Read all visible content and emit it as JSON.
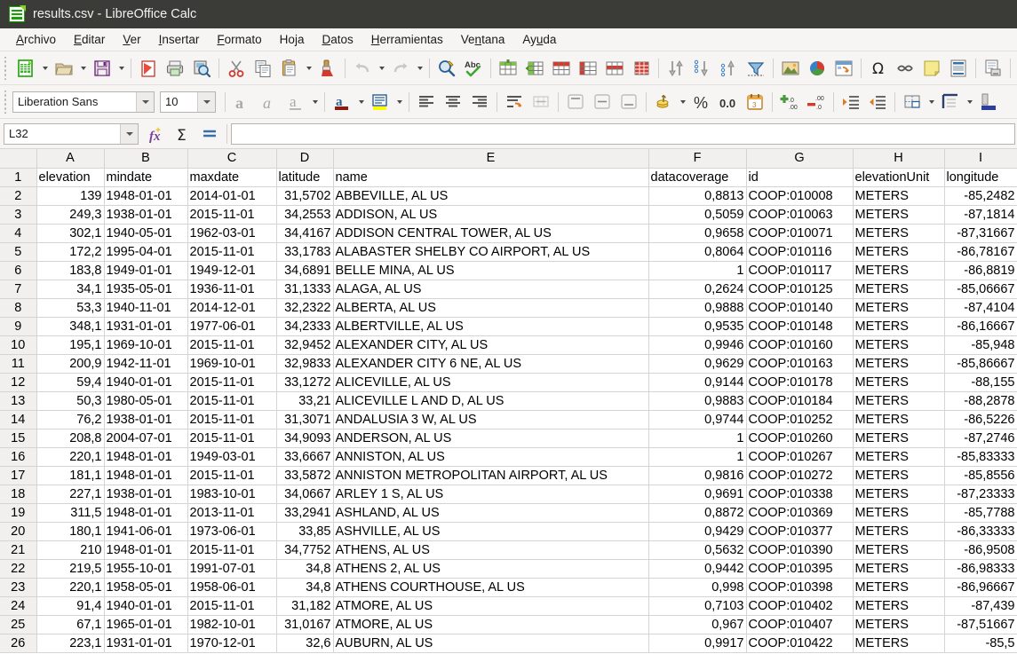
{
  "window": {
    "title": "results.csv - LibreOffice Calc",
    "icon": "calc-document-icon"
  },
  "menubar": {
    "items": [
      {
        "label": "Archivo",
        "accel": "A"
      },
      {
        "label": "Editar",
        "accel": "E"
      },
      {
        "label": "Ver",
        "accel": "V"
      },
      {
        "label": "Insertar",
        "accel": "I"
      },
      {
        "label": "Formato",
        "accel": "F"
      },
      {
        "label": "Hoja",
        "accel": "j"
      },
      {
        "label": "Datos",
        "accel": "D"
      },
      {
        "label": "Herramientas",
        "accel": "H"
      },
      {
        "label": "Ventana",
        "accel": "n"
      },
      {
        "label": "Ayuda",
        "accel": "u"
      }
    ]
  },
  "standard_toolbar": {
    "icons": [
      "new-document-icon",
      "open-file-icon",
      "save-icon",
      "export-pdf-icon",
      "print-icon",
      "print-preview-icon",
      "cut-icon",
      "copy-icon",
      "paste-icon",
      "clone-formatting-icon",
      "undo-icon",
      "redo-icon",
      "find-replace-icon",
      "spelling-icon",
      "insert-table-icon",
      "row-icon",
      "column-icon",
      "delete-row-icon",
      "delete-column-icon",
      "sort-icon",
      "sort-ascending-icon",
      "sort-descending-icon",
      "autofilter-icon",
      "insert-image-icon",
      "insert-chart-icon",
      "pivot-table-icon",
      "special-character-icon",
      "hyperlink-icon",
      "comment-icon",
      "headers-footers-icon",
      "freeze-rows-columns-icon"
    ]
  },
  "formatting_toolbar": {
    "font_name": "Liberation Sans",
    "font_size": "10",
    "icons": [
      "bold-icon",
      "italic-icon",
      "underline-icon",
      "font-color-icon",
      "highlight-color-icon",
      "align-left-icon",
      "align-center-icon",
      "align-right-icon",
      "justified-icon",
      "wrap-text-icon",
      "merge-cells-icon",
      "align-top-icon",
      "align-center-vertical-icon",
      "align-bottom-icon",
      "currency-icon",
      "percent-icon",
      "number-format-icon",
      "date-icon",
      "add-decimal-icon",
      "delete-decimal-icon",
      "increase-indent-icon",
      "decrease-indent-icon",
      "borders-icon",
      "border-style-icon",
      "background-color-icon"
    ]
  },
  "formula_bar": {
    "name_box": "L32",
    "formula_value": "",
    "icons": [
      "function-wizard-icon",
      "sum-icon",
      "formula-icon"
    ]
  },
  "spreadsheet": {
    "column_headers": [
      "A",
      "B",
      "C",
      "D",
      "E",
      "F",
      "G",
      "H",
      "I"
    ],
    "row_numbers": [
      1,
      2,
      3,
      4,
      5,
      6,
      7,
      8,
      9,
      10,
      11,
      12,
      13,
      14,
      15,
      16,
      17,
      18,
      19,
      20,
      21,
      22,
      23,
      24,
      25,
      26
    ],
    "header_row": [
      "elevation",
      "mindate",
      "maxdate",
      "latitude",
      "name",
      "datacoverage",
      "id",
      "elevationUnit",
      "longitude"
    ],
    "rows": [
      [
        "139",
        "1948-01-01",
        "2014-01-01",
        "31,5702",
        "ABBEVILLE, AL US",
        "0,8813",
        "COOP:010008",
        "METERS",
        "-85,2482"
      ],
      [
        "249,3",
        "1938-01-01",
        "2015-11-01",
        "34,2553",
        "ADDISON, AL US",
        "0,5059",
        "COOP:010063",
        "METERS",
        "-87,1814"
      ],
      [
        "302,1",
        "1940-05-01",
        "1962-03-01",
        "34,4167",
        "ADDISON CENTRAL TOWER, AL US",
        "0,9658",
        "COOP:010071",
        "METERS",
        "-87,31667"
      ],
      [
        "172,2",
        "1995-04-01",
        "2015-11-01",
        "33,1783",
        "ALABASTER SHELBY CO AIRPORT, AL US",
        "0,8064",
        "COOP:010116",
        "METERS",
        "-86,78167"
      ],
      [
        "183,8",
        "1949-01-01",
        "1949-12-01",
        "34,6891",
        "BELLE MINA, AL US",
        "1",
        "COOP:010117",
        "METERS",
        "-86,8819"
      ],
      [
        "34,1",
        "1935-05-01",
        "1936-11-01",
        "31,1333",
        "ALAGA, AL US",
        "0,2624",
        "COOP:010125",
        "METERS",
        "-85,06667"
      ],
      [
        "53,3",
        "1940-11-01",
        "2014-12-01",
        "32,2322",
        "ALBERTA, AL US",
        "0,9888",
        "COOP:010140",
        "METERS",
        "-87,4104"
      ],
      [
        "348,1",
        "1931-01-01",
        "1977-06-01",
        "34,2333",
        "ALBERTVILLE, AL US",
        "0,9535",
        "COOP:010148",
        "METERS",
        "-86,16667"
      ],
      [
        "195,1",
        "1969-10-01",
        "2015-11-01",
        "32,9452",
        "ALEXANDER CITY, AL US",
        "0,9946",
        "COOP:010160",
        "METERS",
        "-85,948"
      ],
      [
        "200,9",
        "1942-11-01",
        "1969-10-01",
        "32,9833",
        "ALEXANDER CITY 6 NE, AL US",
        "0,9629",
        "COOP:010163",
        "METERS",
        "-85,86667"
      ],
      [
        "59,4",
        "1940-01-01",
        "2015-11-01",
        "33,1272",
        "ALICEVILLE, AL US",
        "0,9144",
        "COOP:010178",
        "METERS",
        "-88,155"
      ],
      [
        "50,3",
        "1980-05-01",
        "2015-11-01",
        "33,21",
        "ALICEVILLE L AND D, AL US",
        "0,9883",
        "COOP:010184",
        "METERS",
        "-88,2878"
      ],
      [
        "76,2",
        "1938-01-01",
        "2015-11-01",
        "31,3071",
        "ANDALUSIA 3 W, AL US",
        "0,9744",
        "COOP:010252",
        "METERS",
        "-86,5226"
      ],
      [
        "208,8",
        "2004-07-01",
        "2015-11-01",
        "34,9093",
        "ANDERSON, AL US",
        "1",
        "COOP:010260",
        "METERS",
        "-87,2746"
      ],
      [
        "220,1",
        "1948-01-01",
        "1949-03-01",
        "33,6667",
        "ANNISTON, AL US",
        "1",
        "COOP:010267",
        "METERS",
        "-85,83333"
      ],
      [
        "181,1",
        "1948-01-01",
        "2015-11-01",
        "33,5872",
        "ANNISTON METROPOLITAN AIRPORT, AL US",
        "0,9816",
        "COOP:010272",
        "METERS",
        "-85,8556"
      ],
      [
        "227,1",
        "1938-01-01",
        "1983-10-01",
        "34,0667",
        "ARLEY 1 S, AL US",
        "0,9691",
        "COOP:010338",
        "METERS",
        "-87,23333"
      ],
      [
        "311,5",
        "1948-01-01",
        "2013-11-01",
        "33,2941",
        "ASHLAND, AL US",
        "0,8872",
        "COOP:010369",
        "METERS",
        "-85,7788"
      ],
      [
        "180,1",
        "1941-06-01",
        "1973-06-01",
        "33,85",
        "ASHVILLE, AL US",
        "0,9429",
        "COOP:010377",
        "METERS",
        "-86,33333"
      ],
      [
        "210",
        "1948-01-01",
        "2015-11-01",
        "34,7752",
        "ATHENS, AL US",
        "0,5632",
        "COOP:010390",
        "METERS",
        "-86,9508"
      ],
      [
        "219,5",
        "1955-10-01",
        "1991-07-01",
        "34,8",
        "ATHENS 2, AL US",
        "0,9442",
        "COOP:010395",
        "METERS",
        "-86,98333"
      ],
      [
        "220,1",
        "1958-05-01",
        "1958-06-01",
        "34,8",
        "ATHENS COURTHOUSE, AL US",
        "0,998",
        "COOP:010398",
        "METERS",
        "-86,96667"
      ],
      [
        "91,4",
        "1940-01-01",
        "2015-11-01",
        "31,182",
        "ATMORE, AL US",
        "0,7103",
        "COOP:010402",
        "METERS",
        "-87,439"
      ],
      [
        "67,1",
        "1965-01-01",
        "1982-10-01",
        "31,0167",
        "ATMORE, AL US",
        "0,967",
        "COOP:010407",
        "METERS",
        "-87,51667"
      ],
      [
        "223,1",
        "1931-01-01",
        "1970-12-01",
        "32,6",
        "AUBURN, AL US",
        "0,9917",
        "COOP:010422",
        "METERS",
        "-85,5"
      ]
    ]
  },
  "colors": {
    "titlebar_bg": "#3b3b38",
    "toolbar_bg": "#f6f5f4",
    "header_bg": "#f1f0ef",
    "grid_line": "#d4d4d4",
    "accent_green": "#18a303"
  }
}
